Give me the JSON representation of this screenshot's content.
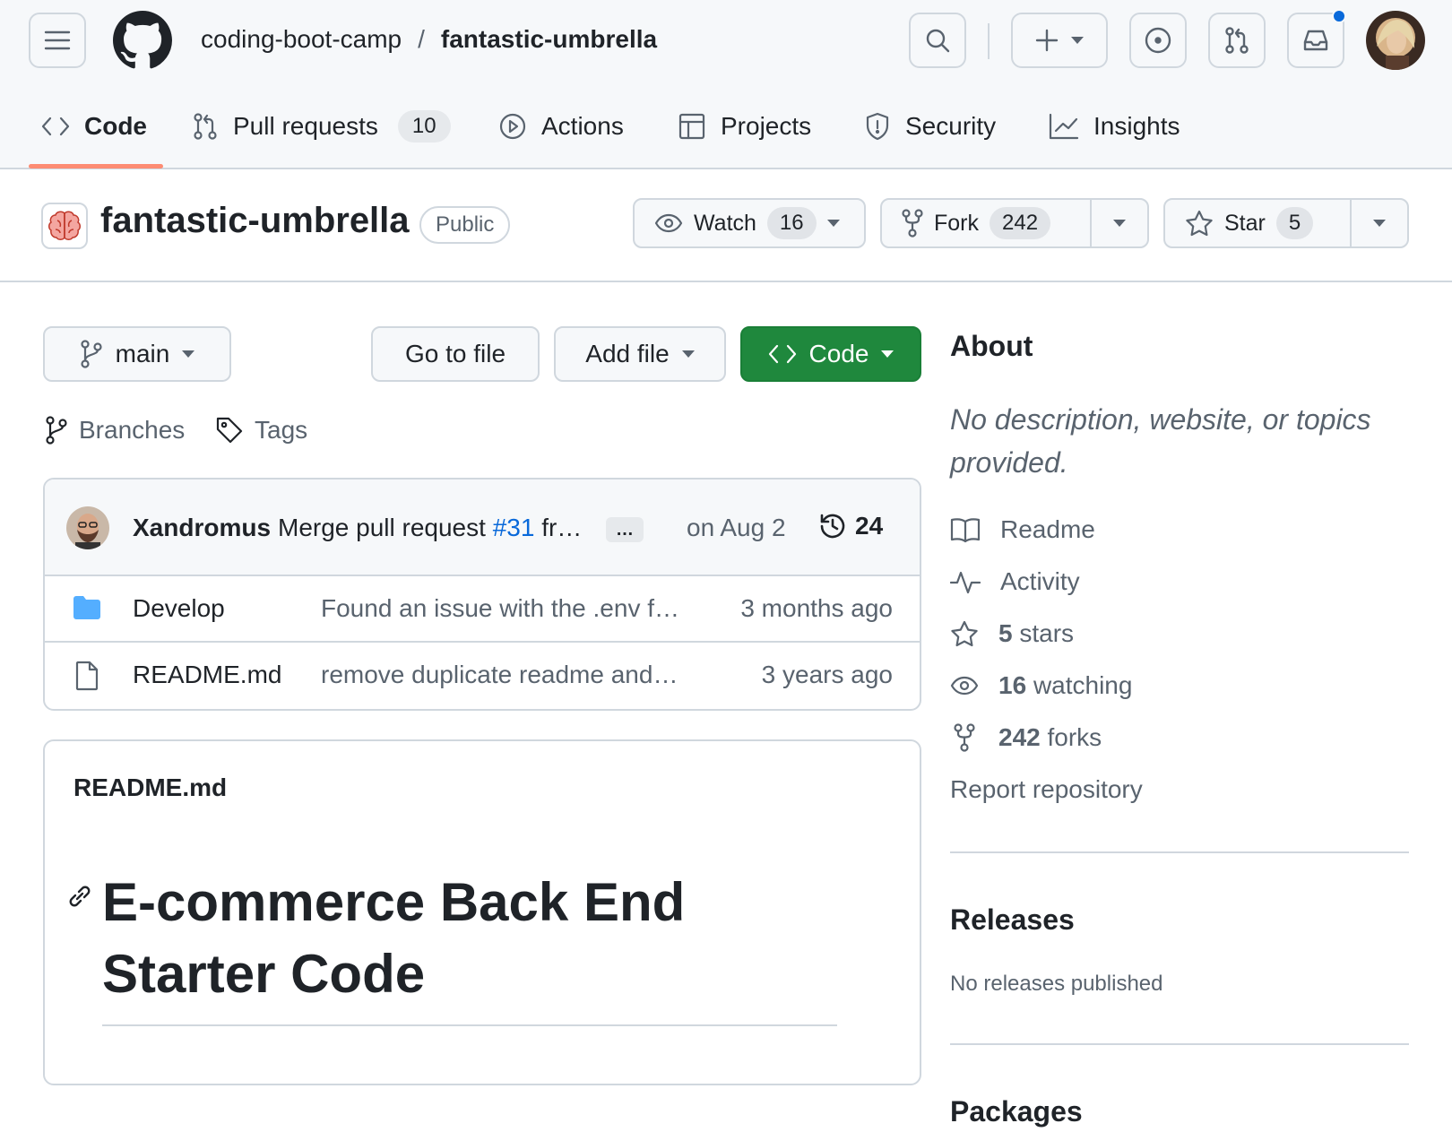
{
  "header": {
    "owner": "coding-boot-camp",
    "separator": "/",
    "repo": "fantastic-umbrella",
    "icons": [
      "menu-icon",
      "github-logo",
      "search-icon",
      "plus-icon",
      "issue-icon",
      "pull-request-icon",
      "inbox-icon"
    ],
    "notification_color": "#0969da"
  },
  "tabs": [
    {
      "label": "Code",
      "icon": "code-icon"
    },
    {
      "label": "Pull requests",
      "icon": "pull-request-icon",
      "count": "10"
    },
    {
      "label": "Actions",
      "icon": "play-icon"
    },
    {
      "label": "Projects",
      "icon": "table-icon"
    },
    {
      "label": "Security",
      "icon": "shield-icon"
    },
    {
      "label": "Insights",
      "icon": "graph-icon"
    }
  ],
  "active_tab_color": "#fd8c73",
  "repo": {
    "name": "fantastic-umbrella",
    "visibility": "Public",
    "watch_label": "Watch",
    "watch_count": "16",
    "fork_label": "Fork",
    "fork_count": "242",
    "star_label": "Star",
    "star_count": "5"
  },
  "actions": {
    "branch": "main",
    "go_to_file": "Go to file",
    "add_file": "Add file",
    "code": "Code",
    "code_color": "#1f883d",
    "branches": "Branches",
    "tags": "Tags"
  },
  "commit": {
    "author": "Xandromus",
    "message_prefix": "Merge pull request",
    "pr_link": "#31",
    "message_suffix": "fr…",
    "ellipsis": "…",
    "date": "on Aug 2",
    "count": "24"
  },
  "files": [
    {
      "name": "Develop",
      "type": "folder",
      "message": "Found an issue with the .env f…",
      "age": "3 months ago"
    },
    {
      "name": "README.md",
      "type": "file",
      "message": "remove duplicate readme and…",
      "age": "3 years ago"
    }
  ],
  "readme": {
    "label": "README.md",
    "heading": "E-commerce Back End Starter Code"
  },
  "sidebar": {
    "about_title": "About",
    "about_desc": "No description, website, or topics provided.",
    "readme": "Readme",
    "activity": "Activity",
    "stars_count": "5",
    "stars_label": "stars",
    "watching_count": "16",
    "watching_label": "watching",
    "forks_count": "242",
    "forks_label": "forks",
    "report": "Report repository",
    "releases_title": "Releases",
    "releases_empty": "No releases published",
    "packages_title": "Packages"
  }
}
